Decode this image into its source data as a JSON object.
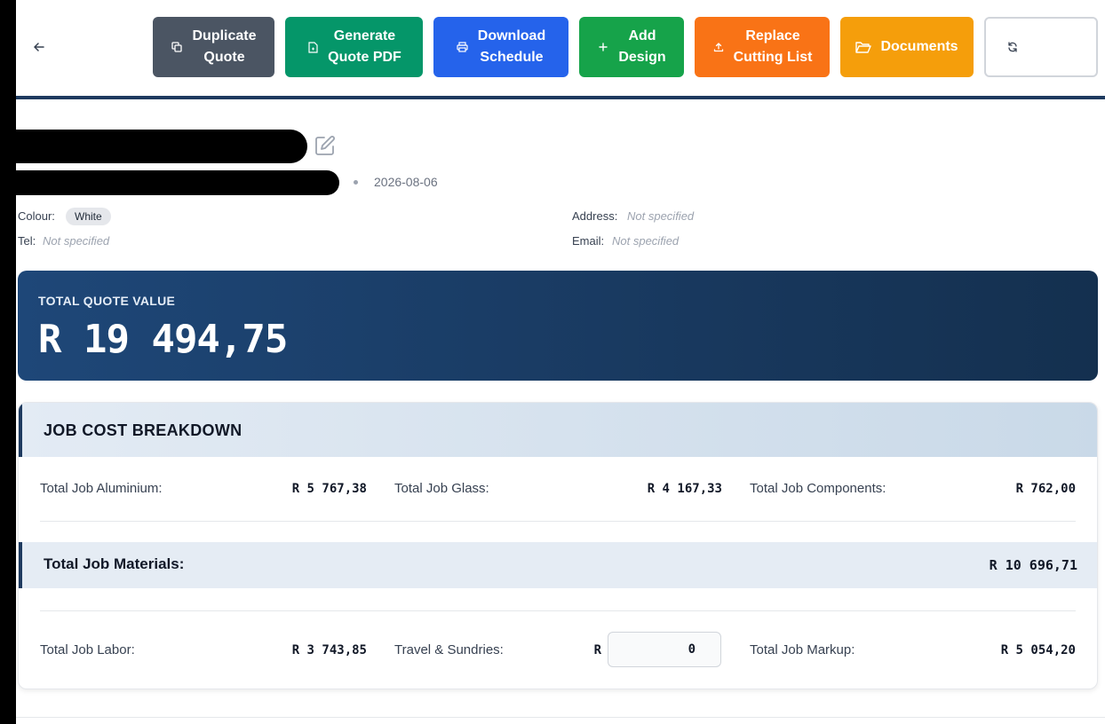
{
  "toolbar": {
    "back": "Back to\nDashboard",
    "duplicate": "Duplicate\nQuote",
    "generate_pdf": "Generate\nQuote PDF",
    "download_schedule": "Download\nSchedule",
    "add_design": "Add\nDesign",
    "replace_cutting": "Replace\nCutting List",
    "documents": "Documents",
    "update_totals": "Update\nTotals"
  },
  "colors": {
    "duplicate": "#4b5563",
    "generate_pdf": "#059669",
    "download_schedule": "#2563eb",
    "add_design": "#16a34a",
    "replace_cutting": "#f97316",
    "documents": "#f59e0b",
    "accent": "#1e3a5f"
  },
  "quote": {
    "date": "2026-08-06",
    "colour_label": "Colour:",
    "colour_value": "White",
    "tel_label": "Tel:",
    "tel_value": "Not specified",
    "address_label": "Address:",
    "address_value": "Not specified",
    "email_label": "Email:",
    "email_value": "Not specified"
  },
  "total": {
    "label": "TOTAL QUOTE VALUE",
    "value": "R 19 494,75"
  },
  "breakdown": {
    "title": "JOB COST BREAKDOWN",
    "aluminium_label": "Total Job Aluminium:",
    "aluminium_value": "R 5 767,38",
    "glass_label": "Total Job Glass:",
    "glass_value": "R 4 167,33",
    "components_label": "Total Job Components:",
    "components_value": "R 762,00",
    "materials_label": "Total Job Materials:",
    "materials_value": "R 10 696,71",
    "labor_label": "Total Job Labor:",
    "labor_value": "R 3 743,85",
    "travel_label": "Travel & Sundries:",
    "travel_currency": "R",
    "travel_value": "0",
    "markup_label": "Total Job Markup:",
    "markup_value": "R 5 054,20"
  }
}
